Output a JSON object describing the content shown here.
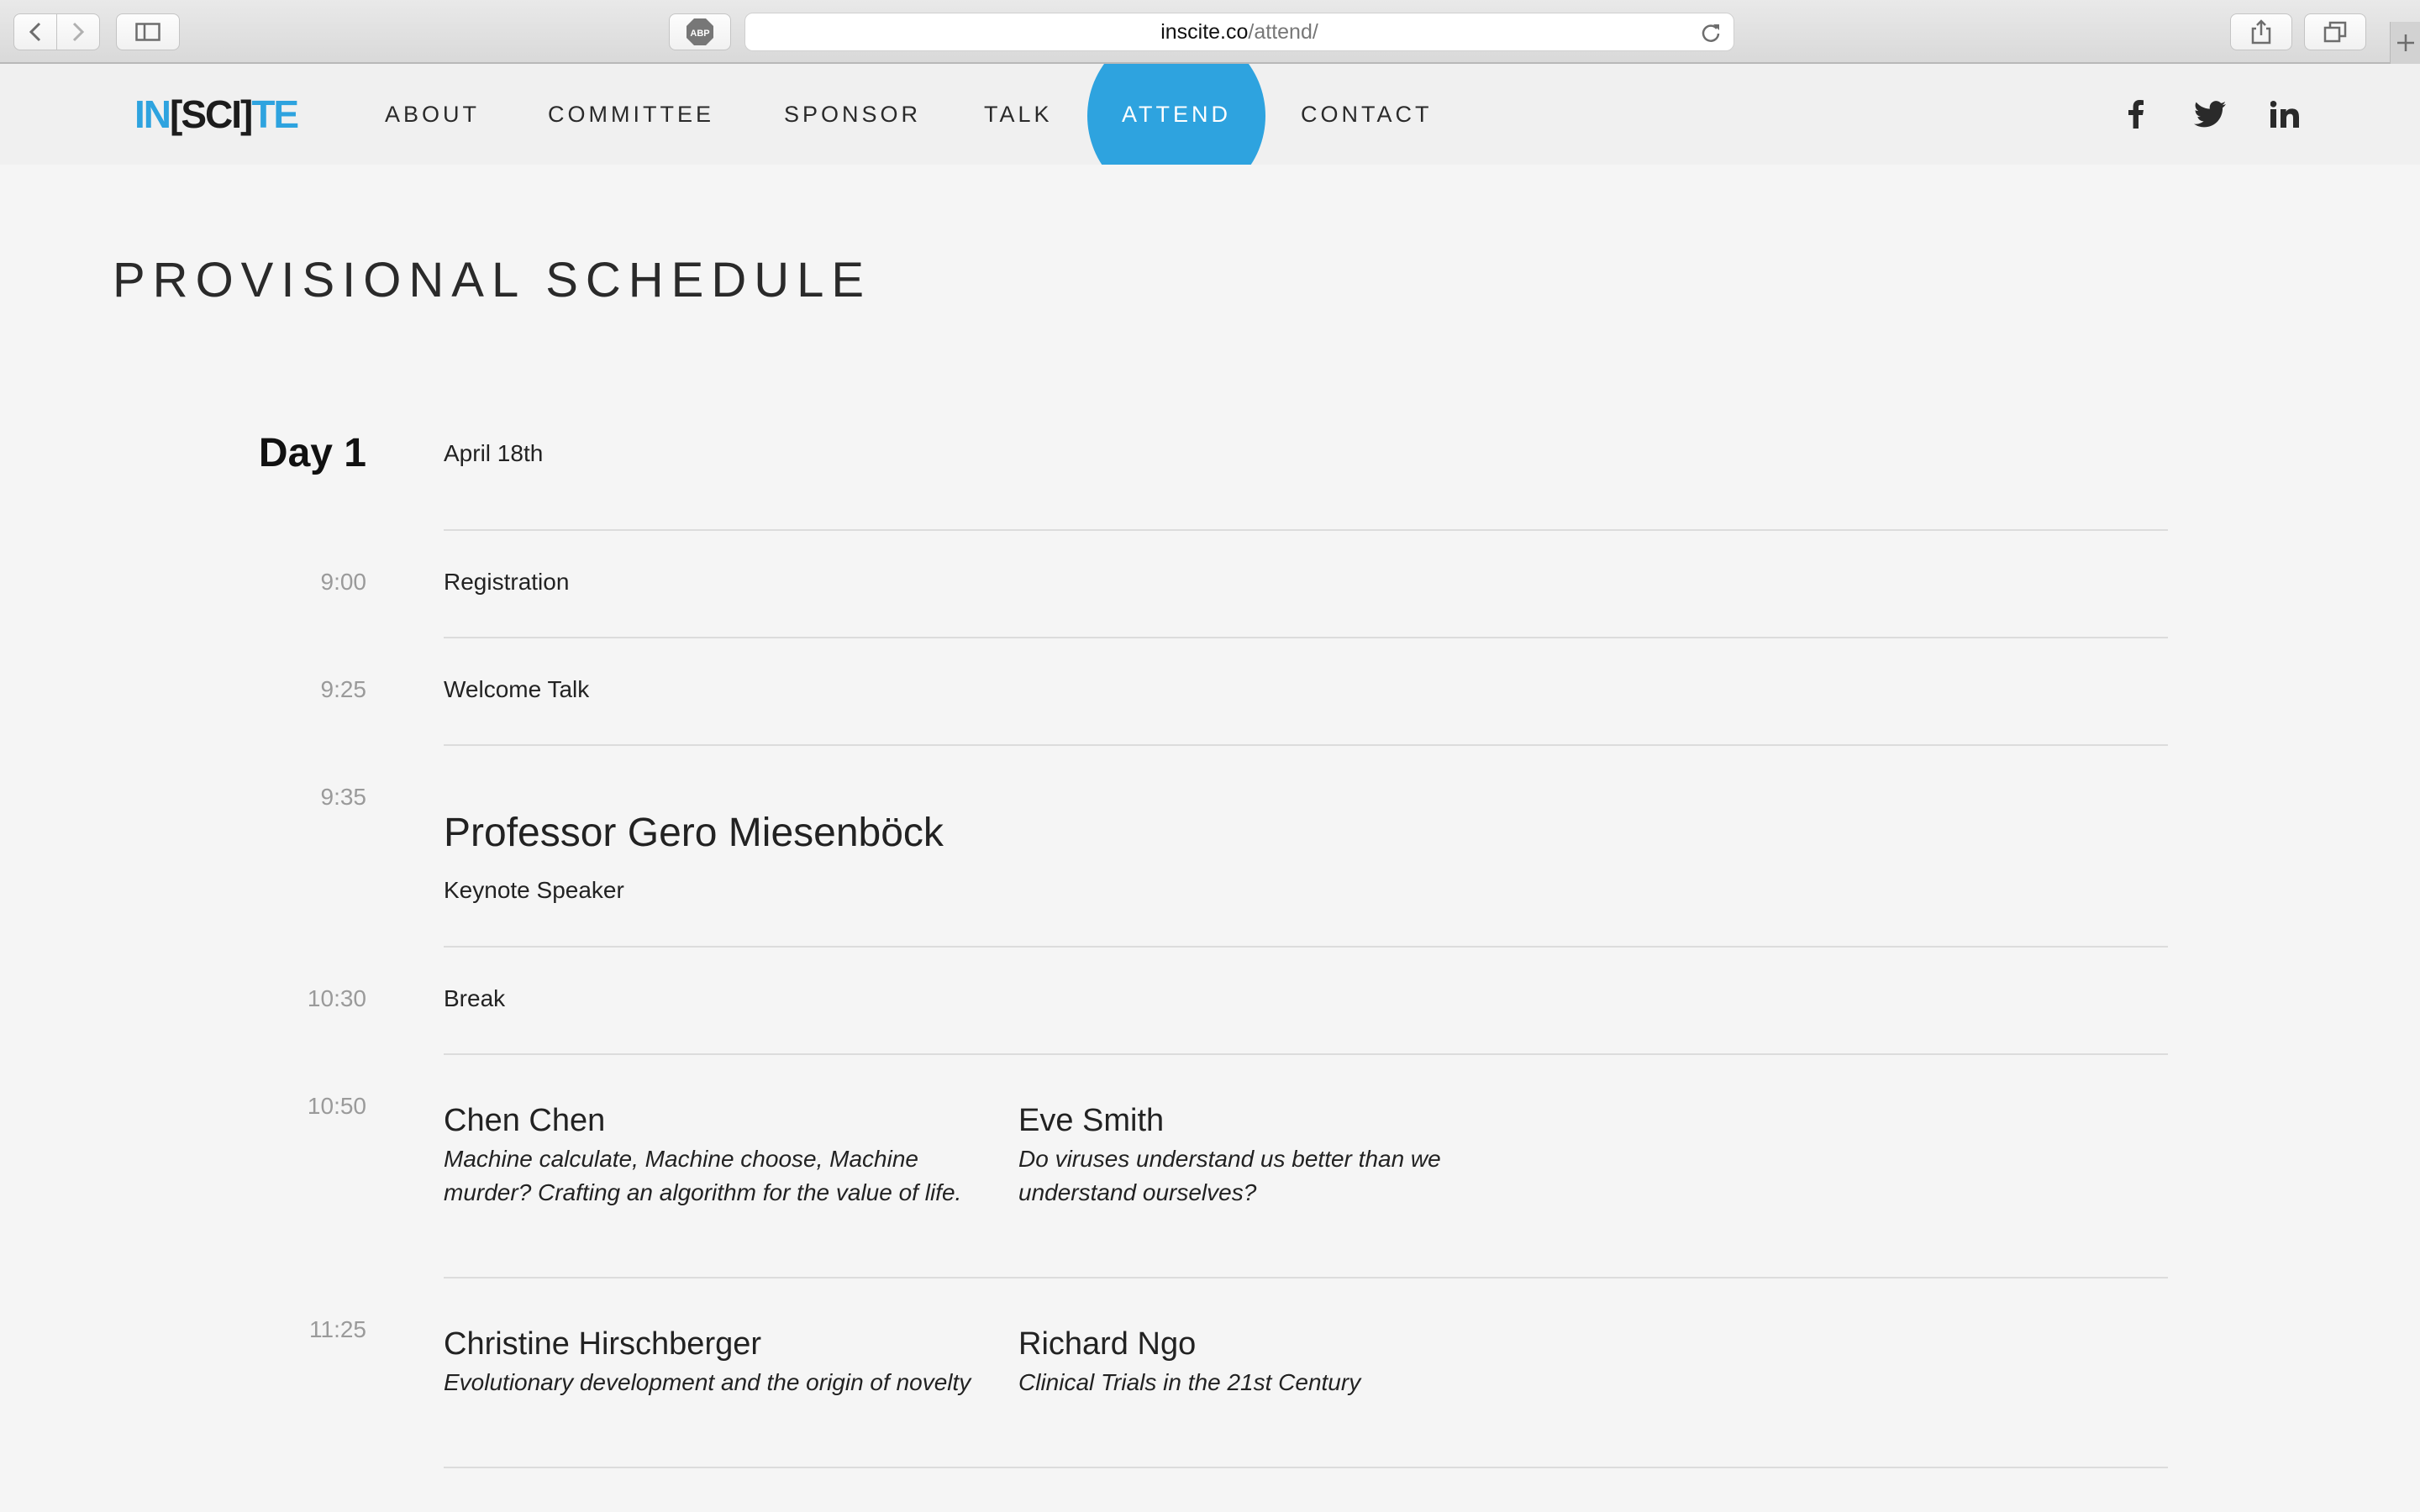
{
  "browser": {
    "url_host": "inscite.co",
    "url_path": "/attend/",
    "adblock_label": "ABP"
  },
  "nav": {
    "logo": {
      "part1": "IN",
      "part2": "[SCI]",
      "part3": "TE"
    },
    "items": [
      {
        "label": "ABOUT"
      },
      {
        "label": "COMMITTEE"
      },
      {
        "label": "SPONSOR"
      },
      {
        "label": "TALK"
      },
      {
        "label": "ATTEND",
        "active": true
      },
      {
        "label": "CONTACT"
      }
    ],
    "social": [
      "facebook-icon",
      "twitter-icon",
      "linkedin-icon"
    ],
    "accent_color": "#2ea3df"
  },
  "page": {
    "title": "PROVISIONAL SCHEDULE"
  },
  "schedule": {
    "day_label": "Day 1",
    "day_date": "April 18th",
    "slots": [
      {
        "time": "9:00",
        "event": "Registration"
      },
      {
        "time": "9:25",
        "event": "Welcome Talk"
      },
      {
        "time": "9:35",
        "speaker": "Professor Gero Miesenböck",
        "role": "Keynote Speaker"
      },
      {
        "time": "10:30",
        "event": "Break"
      },
      {
        "time": "10:50",
        "talks": [
          {
            "speaker": "Chen Chen",
            "title": "Machine calculate, Machine choose, Machine murder? Crafting an algorithm for the value of life."
          },
          {
            "speaker": "Eve Smith",
            "title": "Do viruses understand us better than we understand ourselves?"
          }
        ]
      },
      {
        "time": "11:25",
        "talks": [
          {
            "speaker": "Christine Hirschberger",
            "title": "Evolutionary development and the origin of novelty"
          },
          {
            "speaker": "Richard Ngo",
            "title": "Clinical Trials in the 21st Century"
          }
        ]
      }
    ]
  }
}
